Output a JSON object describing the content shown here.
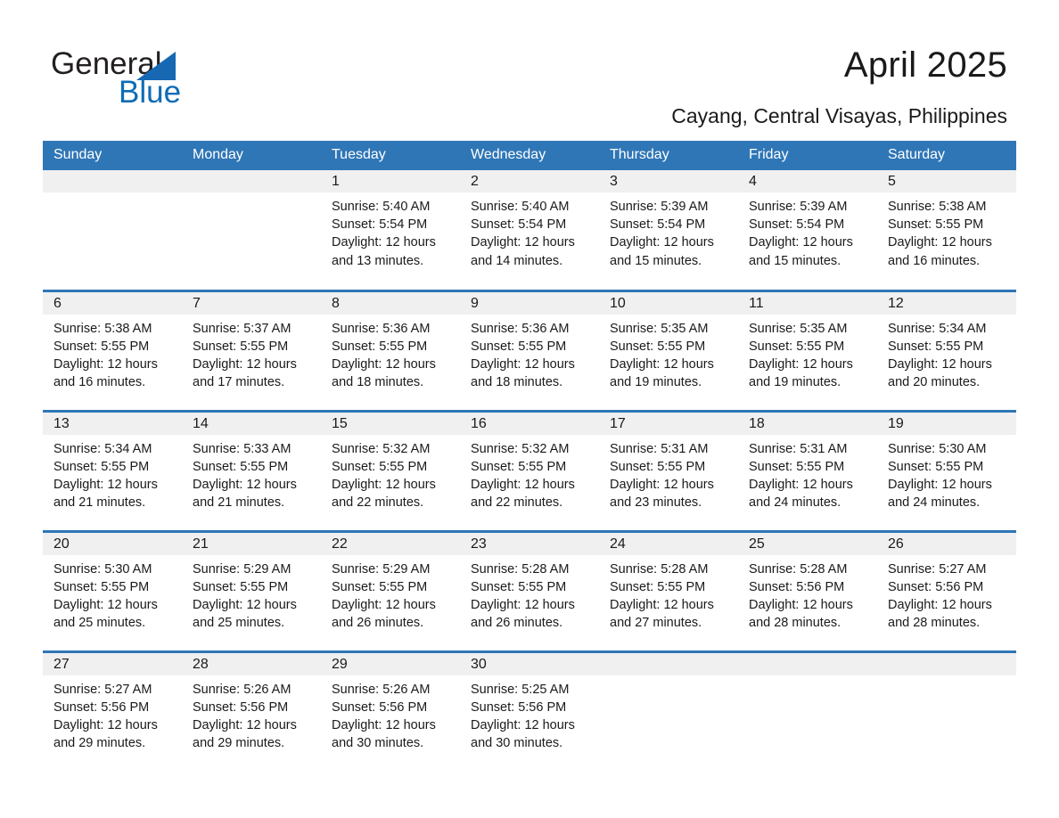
{
  "brand": {
    "name_part1": "General",
    "name_part2": "Blue",
    "triangle_color": "#1668b3",
    "text_color": "#231f20"
  },
  "header": {
    "title": "April 2025",
    "subtitle": "Cayang, Central Visayas, Philippines"
  },
  "theme": {
    "header_blue": "#2f76b6",
    "daynum_band": "#f0f0f0",
    "text": "#1a1a1a"
  },
  "weekdays": [
    "Sunday",
    "Monday",
    "Tuesday",
    "Wednesday",
    "Thursday",
    "Friday",
    "Saturday"
  ],
  "weeks": [
    [
      {
        "day": "",
        "info": ""
      },
      {
        "day": "",
        "info": ""
      },
      {
        "day": "1",
        "info": "Sunrise: 5:40 AM\nSunset: 5:54 PM\nDaylight: 12 hours\nand 13 minutes."
      },
      {
        "day": "2",
        "info": "Sunrise: 5:40 AM\nSunset: 5:54 PM\nDaylight: 12 hours\nand 14 minutes."
      },
      {
        "day": "3",
        "info": "Sunrise: 5:39 AM\nSunset: 5:54 PM\nDaylight: 12 hours\nand 15 minutes."
      },
      {
        "day": "4",
        "info": "Sunrise: 5:39 AM\nSunset: 5:54 PM\nDaylight: 12 hours\nand 15 minutes."
      },
      {
        "day": "5",
        "info": "Sunrise: 5:38 AM\nSunset: 5:55 PM\nDaylight: 12 hours\nand 16 minutes."
      }
    ],
    [
      {
        "day": "6",
        "info": "Sunrise: 5:38 AM\nSunset: 5:55 PM\nDaylight: 12 hours\nand 16 minutes."
      },
      {
        "day": "7",
        "info": "Sunrise: 5:37 AM\nSunset: 5:55 PM\nDaylight: 12 hours\nand 17 minutes."
      },
      {
        "day": "8",
        "info": "Sunrise: 5:36 AM\nSunset: 5:55 PM\nDaylight: 12 hours\nand 18 minutes."
      },
      {
        "day": "9",
        "info": "Sunrise: 5:36 AM\nSunset: 5:55 PM\nDaylight: 12 hours\nand 18 minutes."
      },
      {
        "day": "10",
        "info": "Sunrise: 5:35 AM\nSunset: 5:55 PM\nDaylight: 12 hours\nand 19 minutes."
      },
      {
        "day": "11",
        "info": "Sunrise: 5:35 AM\nSunset: 5:55 PM\nDaylight: 12 hours\nand 19 minutes."
      },
      {
        "day": "12",
        "info": "Sunrise: 5:34 AM\nSunset: 5:55 PM\nDaylight: 12 hours\nand 20 minutes."
      }
    ],
    [
      {
        "day": "13",
        "info": "Sunrise: 5:34 AM\nSunset: 5:55 PM\nDaylight: 12 hours\nand 21 minutes."
      },
      {
        "day": "14",
        "info": "Sunrise: 5:33 AM\nSunset: 5:55 PM\nDaylight: 12 hours\nand 21 minutes."
      },
      {
        "day": "15",
        "info": "Sunrise: 5:32 AM\nSunset: 5:55 PM\nDaylight: 12 hours\nand 22 minutes."
      },
      {
        "day": "16",
        "info": "Sunrise: 5:32 AM\nSunset: 5:55 PM\nDaylight: 12 hours\nand 22 minutes."
      },
      {
        "day": "17",
        "info": "Sunrise: 5:31 AM\nSunset: 5:55 PM\nDaylight: 12 hours\nand 23 minutes."
      },
      {
        "day": "18",
        "info": "Sunrise: 5:31 AM\nSunset: 5:55 PM\nDaylight: 12 hours\nand 24 minutes."
      },
      {
        "day": "19",
        "info": "Sunrise: 5:30 AM\nSunset: 5:55 PM\nDaylight: 12 hours\nand 24 minutes."
      }
    ],
    [
      {
        "day": "20",
        "info": "Sunrise: 5:30 AM\nSunset: 5:55 PM\nDaylight: 12 hours\nand 25 minutes."
      },
      {
        "day": "21",
        "info": "Sunrise: 5:29 AM\nSunset: 5:55 PM\nDaylight: 12 hours\nand 25 minutes."
      },
      {
        "day": "22",
        "info": "Sunrise: 5:29 AM\nSunset: 5:55 PM\nDaylight: 12 hours\nand 26 minutes."
      },
      {
        "day": "23",
        "info": "Sunrise: 5:28 AM\nSunset: 5:55 PM\nDaylight: 12 hours\nand 26 minutes."
      },
      {
        "day": "24",
        "info": "Sunrise: 5:28 AM\nSunset: 5:55 PM\nDaylight: 12 hours\nand 27 minutes."
      },
      {
        "day": "25",
        "info": "Sunrise: 5:28 AM\nSunset: 5:56 PM\nDaylight: 12 hours\nand 28 minutes."
      },
      {
        "day": "26",
        "info": "Sunrise: 5:27 AM\nSunset: 5:56 PM\nDaylight: 12 hours\nand 28 minutes."
      }
    ],
    [
      {
        "day": "27",
        "info": "Sunrise: 5:27 AM\nSunset: 5:56 PM\nDaylight: 12 hours\nand 29 minutes."
      },
      {
        "day": "28",
        "info": "Sunrise: 5:26 AM\nSunset: 5:56 PM\nDaylight: 12 hours\nand 29 minutes."
      },
      {
        "day": "29",
        "info": "Sunrise: 5:26 AM\nSunset: 5:56 PM\nDaylight: 12 hours\nand 30 minutes."
      },
      {
        "day": "30",
        "info": "Sunrise: 5:25 AM\nSunset: 5:56 PM\nDaylight: 12 hours\nand 30 minutes."
      },
      {
        "day": "",
        "info": ""
      },
      {
        "day": "",
        "info": ""
      },
      {
        "day": "",
        "info": ""
      }
    ]
  ]
}
